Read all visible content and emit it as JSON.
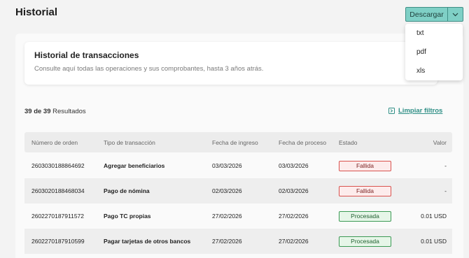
{
  "header": {
    "title": "Historial"
  },
  "download": {
    "label": "Descargar",
    "options": [
      "txt",
      "pdf",
      "xls"
    ]
  },
  "card": {
    "title": "Historial de transacciones",
    "description": "Consulte aquí todas las operaciones y sus comprobantes, hasta 3 años atrás."
  },
  "results": {
    "count": "39 de 39",
    "suffix": " Resultados"
  },
  "clear_filters": "Limpiar filtros",
  "table": {
    "headers": [
      "Número de orden",
      "Tipo de transacción",
      "Fecha de ingreso",
      "Fecha de proceso",
      "Estado",
      "Valor"
    ],
    "rows": [
      {
        "order": "2603030188864692",
        "type": "Agregar beneficiarios",
        "entry": "03/03/2026",
        "process": "03/03/2026",
        "status": "Fallida",
        "value": "-"
      },
      {
        "order": "2603020188468034",
        "type": "Pago de nómina",
        "entry": "02/03/2026",
        "process": "02/03/2026",
        "status": "Fallida",
        "value": "-"
      },
      {
        "order": "2602270187911572",
        "type": "Pago TC propias",
        "entry": "27/02/2026",
        "process": "27/02/2026",
        "status": "Procesada",
        "value": "0.01 USD"
      },
      {
        "order": "2602270187910599",
        "type": "Pagar tarjetas de otros bancos",
        "entry": "27/02/2026",
        "process": "27/02/2026",
        "status": "Procesada",
        "value": "0.01 USD"
      }
    ]
  },
  "colors": {
    "accent": "#7fd0c6",
    "fail": "#d9534f",
    "ok": "#3c9a55",
    "link": "#2f8f86"
  }
}
